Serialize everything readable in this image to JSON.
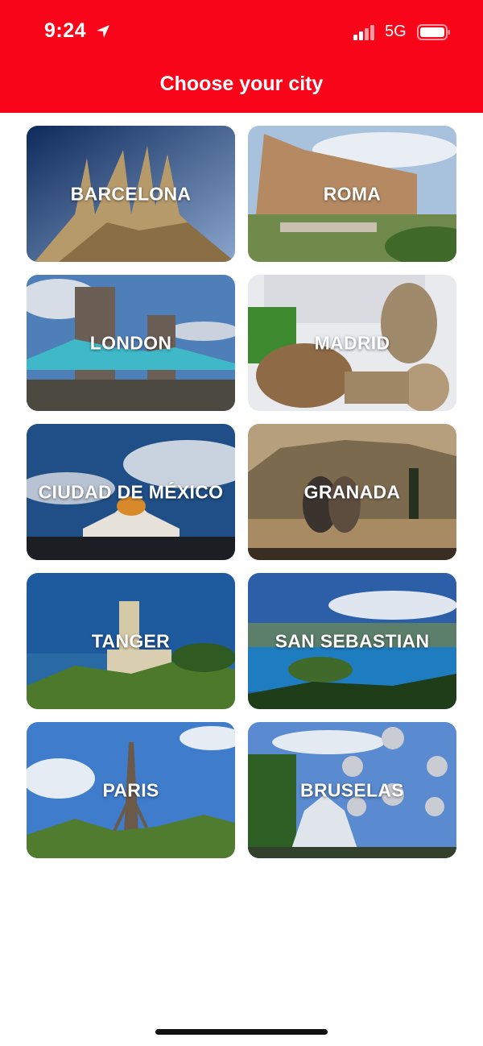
{
  "status_bar": {
    "time": "9:24",
    "network": "5G",
    "icons": [
      "location-arrow-icon",
      "signal-bars-icon",
      "battery-icon"
    ]
  },
  "header": {
    "title": "Choose your city",
    "background_color": "#f8051a"
  },
  "cities": [
    {
      "name": "BARCELONA"
    },
    {
      "name": "ROMA"
    },
    {
      "name": "LONDON"
    },
    {
      "name": "MADRID"
    },
    {
      "name": "CIUDAD DE MÉXICO"
    },
    {
      "name": "GRANADA"
    },
    {
      "name": "TANGER"
    },
    {
      "name": "SAN SEBASTIAN"
    },
    {
      "name": "PARIS"
    },
    {
      "name": "BRUSELAS"
    }
  ]
}
